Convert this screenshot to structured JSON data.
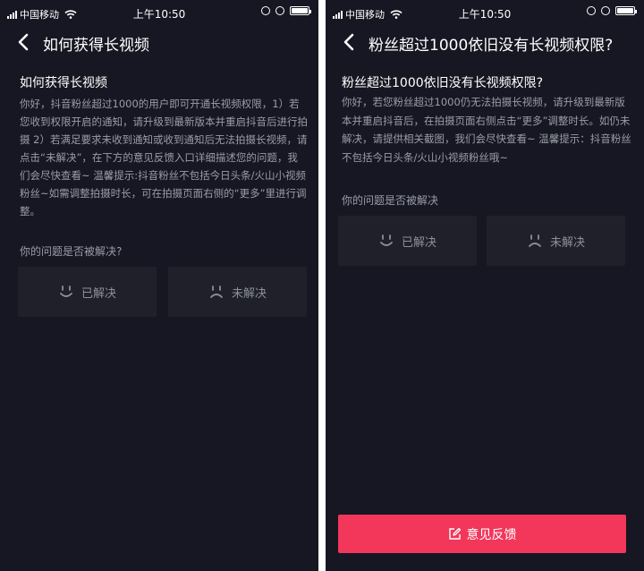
{
  "colors": {
    "background": "#161722",
    "button_bg": "#1f2029",
    "accent": "#f2375a",
    "body_text": "#9a9ca6",
    "title_text": "#ffffff"
  },
  "status_bar": {
    "carrier": "中国移动",
    "time": "上午10:50",
    "icons": [
      "signal-icon",
      "wifi-icon",
      "orientation-lock-icon",
      "alarm-icon",
      "battery-icon"
    ]
  },
  "left_screen": {
    "nav_title": "如何获得长视频",
    "question_title": "如何获得长视频",
    "answer": "你好，抖音粉丝超过1000的用户即可开通长视频权限，1）若您收到权限开启的通知，请升级到最新版本并重启抖音后进行拍摄 2）若满足要求未收到通知或收到通知后无法拍摄长视频，请点击“未解决”，在下方的意见反馈入口详细描述您的问题，我们会尽快查看~ 温馨提示:抖音粉丝不包括今日头条/火山小视频粉丝~如需调整拍摄时长，可在拍摄页面右侧的“更多”里进行调整。",
    "solved_question": "你的问题是否被解决?",
    "solved_label": "已解决",
    "unsolved_label": "未解决"
  },
  "right_screen": {
    "nav_title": "粉丝超过1000依旧没有长视频权限?",
    "question_title": "粉丝超过1000依旧没有长视频权限?",
    "answer": "你好，若您粉丝超过1000仍无法拍摄长视频，请升级到最新版本并重启抖音后，在拍摄页面右侧点击“更多”调整时长。如仍未解决，请提供相关截图，我们会尽快查看~ 温馨提示：抖音粉丝不包括今日头条/火山小视频粉丝哦~",
    "solved_question": "你的问题是否被解决",
    "solved_label": "已解决",
    "unsolved_label": "未解决",
    "feedback_button": "意见反馈"
  }
}
